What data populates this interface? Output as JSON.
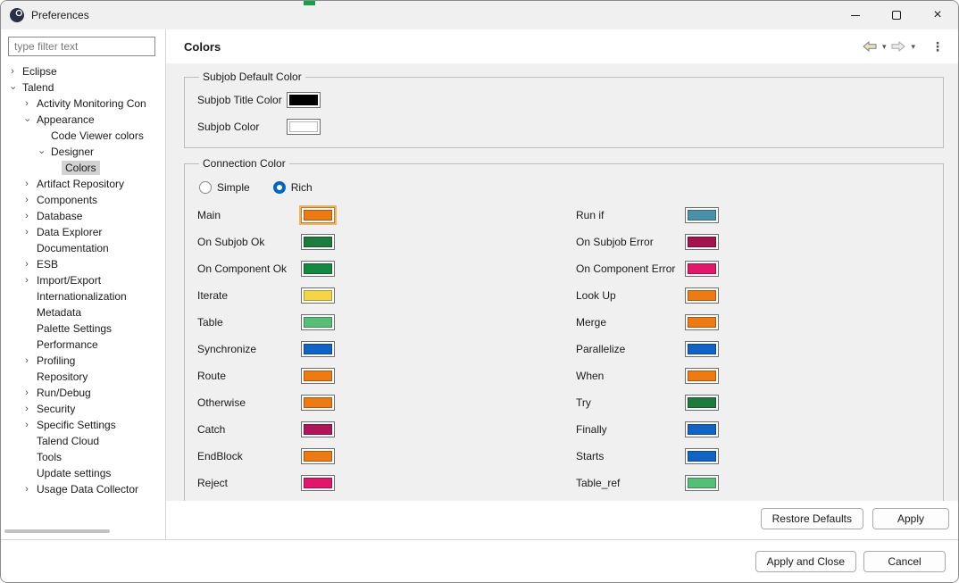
{
  "window": {
    "title": "Preferences",
    "controls": {
      "minimize": "minimize",
      "maximize": "maximize",
      "close": "×"
    }
  },
  "icons": {
    "chevron_collapsed": "›",
    "chevron_dropdown": "▾",
    "view_menu": "⋮"
  },
  "colors_meta": {
    "accent_blue": "#0067c0",
    "selection_gray": "#d2d2d2",
    "content_bg": "#f0f0f0"
  },
  "sidebar": {
    "filter_placeholder": "type filter text",
    "tree": [
      {
        "label": "Eclipse",
        "level": 0,
        "state": "collapsed",
        "selected": false
      },
      {
        "label": "Talend",
        "level": 0,
        "state": "expanded",
        "selected": false
      },
      {
        "label": "Activity Monitoring Con",
        "level": 1,
        "state": "collapsed",
        "selected": false
      },
      {
        "label": "Appearance",
        "level": 1,
        "state": "expanded",
        "selected": false
      },
      {
        "label": "Code Viewer colors",
        "level": 2,
        "state": "none",
        "selected": false
      },
      {
        "label": "Designer",
        "level": 2,
        "state": "expanded",
        "selected": false
      },
      {
        "label": "Colors",
        "level": 3,
        "state": "none",
        "selected": true
      },
      {
        "label": "Artifact Repository",
        "level": 1,
        "state": "collapsed",
        "selected": false
      },
      {
        "label": "Components",
        "level": 1,
        "state": "collapsed",
        "selected": false
      },
      {
        "label": "Database",
        "level": 1,
        "state": "collapsed",
        "selected": false
      },
      {
        "label": "Data Explorer",
        "level": 1,
        "state": "collapsed",
        "selected": false
      },
      {
        "label": "Documentation",
        "level": 1,
        "state": "none",
        "selected": false
      },
      {
        "label": "ESB",
        "level": 1,
        "state": "collapsed",
        "selected": false
      },
      {
        "label": "Import/Export",
        "level": 1,
        "state": "collapsed",
        "selected": false
      },
      {
        "label": "Internationalization",
        "level": 1,
        "state": "none",
        "selected": false
      },
      {
        "label": "Metadata",
        "level": 1,
        "state": "none",
        "selected": false
      },
      {
        "label": "Palette Settings",
        "level": 1,
        "state": "none",
        "selected": false
      },
      {
        "label": "Performance",
        "level": 1,
        "state": "none",
        "selected": false
      },
      {
        "label": "Profiling",
        "level": 1,
        "state": "collapsed",
        "selected": false
      },
      {
        "label": "Repository",
        "level": 1,
        "state": "none",
        "selected": false
      },
      {
        "label": "Run/Debug",
        "level": 1,
        "state": "collapsed",
        "selected": false
      },
      {
        "label": "Security",
        "level": 1,
        "state": "collapsed",
        "selected": false
      },
      {
        "label": "Specific Settings",
        "level": 1,
        "state": "collapsed",
        "selected": false
      },
      {
        "label": "Talend Cloud",
        "level": 1,
        "state": "none",
        "selected": false
      },
      {
        "label": "Tools",
        "level": 1,
        "state": "none",
        "selected": false
      },
      {
        "label": "Update settings",
        "level": 1,
        "state": "none",
        "selected": false
      },
      {
        "label": "Usage Data Collector",
        "level": 1,
        "state": "collapsed",
        "selected": false
      }
    ]
  },
  "main": {
    "title": "Colors",
    "subjob": {
      "group_title": "Subjob Default Color",
      "rows": [
        {
          "label": "Subjob Title Color",
          "color": "#000000",
          "focused": false
        },
        {
          "label": "Subjob Color",
          "color": "#fdfdfd",
          "focused": false
        }
      ]
    },
    "connection": {
      "group_title": "Connection Color",
      "radios": [
        {
          "label": "Simple",
          "selected": false
        },
        {
          "label": "Rich",
          "selected": true
        }
      ],
      "left": [
        {
          "label": "Main",
          "color": "#ed7a12",
          "focused": true
        },
        {
          "label": "On Subjob Ok",
          "color": "#1f7a3d",
          "focused": false
        },
        {
          "label": "On Component Ok",
          "color": "#158843",
          "focused": false
        },
        {
          "label": "Iterate",
          "color": "#f5d445",
          "focused": false
        },
        {
          "label": "Table",
          "color": "#57be76",
          "focused": false
        },
        {
          "label": "Synchronize",
          "color": "#1263c6",
          "focused": false
        },
        {
          "label": "Route",
          "color": "#ed7a12",
          "focused": false
        },
        {
          "label": "Otherwise",
          "color": "#ed7a12",
          "focused": false
        },
        {
          "label": "Catch",
          "color": "#b0155a",
          "focused": false
        },
        {
          "label": "EndBlock",
          "color": "#ed7a12",
          "focused": false
        },
        {
          "label": "Reject",
          "color": "#e2166b",
          "focused": false
        }
      ],
      "right": [
        {
          "label": "Run if",
          "color": "#4a90a8",
          "focused": false
        },
        {
          "label": "On Subjob Error",
          "color": "#a41250",
          "focused": false
        },
        {
          "label": "On Component Error",
          "color": "#e2166b",
          "focused": false
        },
        {
          "label": "Look Up",
          "color": "#ed7a12",
          "focused": false
        },
        {
          "label": "Merge",
          "color": "#ed7a12",
          "focused": false
        },
        {
          "label": "Parallelize",
          "color": "#1263c6",
          "focused": false
        },
        {
          "label": "When",
          "color": "#ed7a12",
          "focused": false
        },
        {
          "label": "Try",
          "color": "#1f7a3d",
          "focused": false
        },
        {
          "label": "Finally",
          "color": "#1263c6",
          "focused": false
        },
        {
          "label": "Starts",
          "color": "#1263c6",
          "focused": false
        },
        {
          "label": "Table_ref",
          "color": "#57be76",
          "focused": false
        }
      ]
    },
    "buttons": {
      "restore_defaults": "Restore Defaults",
      "apply": "Apply"
    }
  },
  "footer": {
    "apply_and_close": "Apply and Close",
    "cancel": "Cancel"
  }
}
